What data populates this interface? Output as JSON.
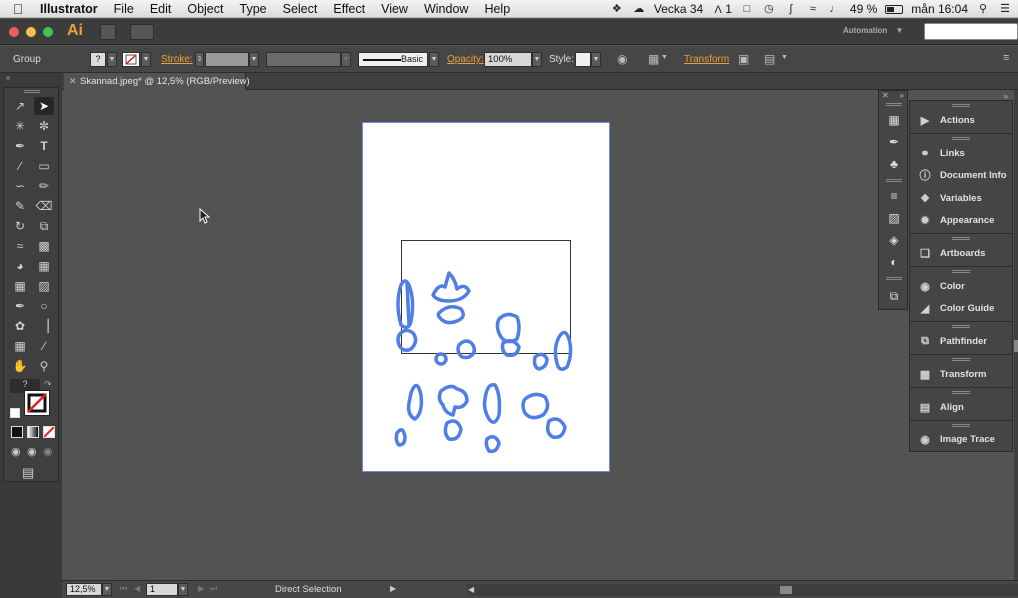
{
  "menubar": {
    "app_name": "Illustrator",
    "items": [
      "File",
      "Edit",
      "Object",
      "Type",
      "Select",
      "Effect",
      "View",
      "Window",
      "Help"
    ],
    "week": "Vecka 34",
    "adobe_status": "1",
    "battery": "49 %",
    "clock": "mån 16:04"
  },
  "appbar": {
    "logo": "Ai",
    "workspace": "Automation",
    "traffic_colors": [
      "#f25c54",
      "#f6be4f",
      "#3dc64d"
    ]
  },
  "control": {
    "selection_type": "Group",
    "stroke_label": "Stroke:",
    "stroke_style": "Basic",
    "opacity_label": "Opacity:",
    "opacity_value": "100%",
    "style_label": "Style:",
    "transform_label": "Transform",
    "fill_value": "?"
  },
  "document": {
    "tab_title": "Skannad.jpeg* @ 12,5% (RGB/Preview)"
  },
  "toolpanel": {
    "fill_placeholder": "?"
  },
  "statusbar": {
    "zoom": "12,5%",
    "artboard_number": "1",
    "current_tool": "Direct Selection"
  },
  "panels": [
    {
      "label": "Actions",
      "icon": "play-icon"
    },
    {
      "label": "Links",
      "icon": "link-icon"
    },
    {
      "label": "Document Info",
      "icon": "info-icon"
    },
    {
      "label": "Variables",
      "icon": "variables-icon"
    },
    {
      "label": "Appearance",
      "icon": "appearance-icon"
    },
    {
      "label": "Artboards",
      "icon": "artboards-icon"
    },
    {
      "label": "Color",
      "icon": "color-icon"
    },
    {
      "label": "Color Guide",
      "icon": "color-guide-icon"
    },
    {
      "label": "Pathfinder",
      "icon": "pathfinder-icon"
    },
    {
      "label": "Transform",
      "icon": "transform-icon"
    },
    {
      "label": "Align",
      "icon": "align-icon"
    },
    {
      "label": "Image Trace",
      "icon": "image-trace-icon"
    }
  ],
  "colors": {
    "accent_link": "#e8a13a",
    "artboard_border": "#6a86e8",
    "traced_blue": "#4e7ee6"
  }
}
